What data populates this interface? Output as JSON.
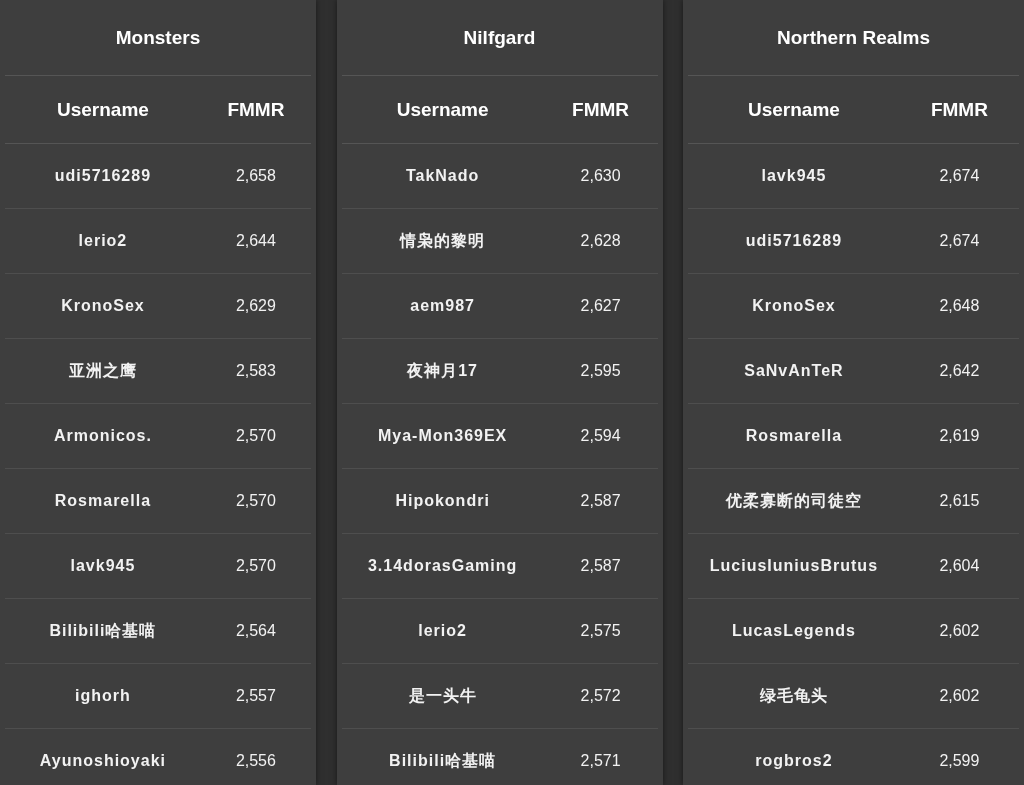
{
  "tables": [
    {
      "title": "Monsters",
      "columns": [
        "Username",
        "FMMR"
      ],
      "rows": [
        {
          "username": "udi5716289",
          "fmmr": "2,658"
        },
        {
          "username": "lerio2",
          "fmmr": "2,644"
        },
        {
          "username": "KronoSex",
          "fmmr": "2,629"
        },
        {
          "username": "亚洲之鹰",
          "fmmr": "2,583"
        },
        {
          "username": "Armonicos.",
          "fmmr": "2,570"
        },
        {
          "username": "Rosmarella",
          "fmmr": "2,570"
        },
        {
          "username": "lavk945",
          "fmmr": "2,570"
        },
        {
          "username": "Bilibili哈基喵",
          "fmmr": "2,564"
        },
        {
          "username": "ighorh",
          "fmmr": "2,557"
        },
        {
          "username": "Ayunoshioyaki",
          "fmmr": "2,556"
        }
      ]
    },
    {
      "title": "Nilfgard",
      "columns": [
        "Username",
        "FMMR"
      ],
      "rows": [
        {
          "username": "TakNado",
          "fmmr": "2,630"
        },
        {
          "username": "情枭的黎明",
          "fmmr": "2,628"
        },
        {
          "username": "aem987",
          "fmmr": "2,627"
        },
        {
          "username": "夜神月17",
          "fmmr": "2,595"
        },
        {
          "username": "Mya-Mon369EX",
          "fmmr": "2,594"
        },
        {
          "username": "Hipokondri",
          "fmmr": "2,587"
        },
        {
          "username": "3.14dorasGaming",
          "fmmr": "2,587"
        },
        {
          "username": "lerio2",
          "fmmr": "2,575"
        },
        {
          "username": "是一头牛",
          "fmmr": "2,572"
        },
        {
          "username": "Bilibili哈基喵",
          "fmmr": "2,571"
        }
      ]
    },
    {
      "title": "Northern Realms",
      "columns": [
        "Username",
        "FMMR"
      ],
      "rows": [
        {
          "username": "lavk945",
          "fmmr": "2,674"
        },
        {
          "username": "udi5716289",
          "fmmr": "2,674"
        },
        {
          "username": "KronoSex",
          "fmmr": "2,648"
        },
        {
          "username": "SaNvAnTeR",
          "fmmr": "2,642"
        },
        {
          "username": "Rosmarella",
          "fmmr": "2,619"
        },
        {
          "username": "优柔寡断的司徒空",
          "fmmr": "2,615"
        },
        {
          "username": "LuciusIuniusBrutus",
          "fmmr": "2,604"
        },
        {
          "username": "LucasLegends",
          "fmmr": "2,602"
        },
        {
          "username": "绿毛龟头",
          "fmmr": "2,602"
        },
        {
          "username": "rogbros2",
          "fmmr": "2,599"
        }
      ]
    }
  ]
}
